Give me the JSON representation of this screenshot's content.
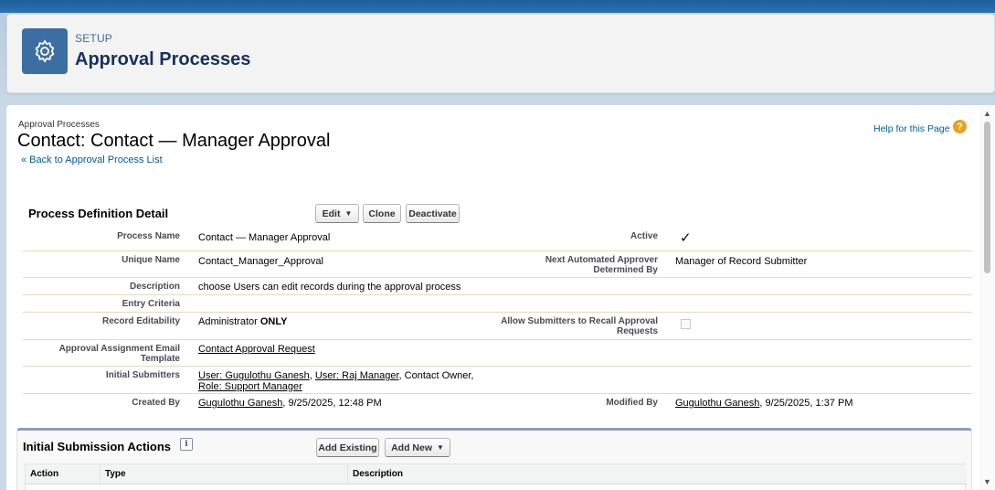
{
  "header": {
    "setup_label": "SETUP",
    "title": "Approval Processes"
  },
  "page": {
    "type_label": "Approval Processes",
    "record_title": "Contact: Contact — Manager Approval",
    "back_link": "Back to Approval Process List",
    "back_prefix": "«",
    "help_link": "Help for this Page",
    "help_icon": "?"
  },
  "detail": {
    "section_title": "Process Definition Detail",
    "buttons": {
      "edit": "Edit",
      "clone": "Clone",
      "deactivate": "Deactivate"
    },
    "fields": {
      "process_name_label": "Process Name",
      "process_name": "Contact — Manager Approval",
      "active_label": "Active",
      "active_checked": true,
      "unique_name_label": "Unique Name",
      "unique_name": "Contact_Manager_Approval",
      "next_approver_label": "Next Automated Approver Determined By",
      "next_approver": "Manager of Record Submitter",
      "description_label": "Description",
      "description": "choose Users can edit records during the approval process",
      "entry_criteria_label": "Entry Criteria",
      "entry_criteria": "",
      "record_editability_label": "Record Editability",
      "record_editability_prefix": "Administrator ",
      "record_editability_bold": "ONLY",
      "allow_recall_label": "Allow Submitters to Recall Approval Requests",
      "allow_recall_checked": false,
      "email_template_label": "Approval Assignment Email Template",
      "email_template": "Contact Approval Request",
      "initial_submitters_label": "Initial Submitters",
      "submitter_1": "User: Gugulothu Ganesh",
      "submitter_2": "User: Raj Manager",
      "submitter_3": "Contact Owner,",
      "submitter_4": "Role: Support Manager",
      "created_by_label": "Created By",
      "created_by_user": "Gugulothu Ganesh",
      "created_by_date": ", 9/25/2025, 12:48 PM",
      "modified_by_label": "Modified By",
      "modified_by_user": "Gugulothu Ganesh",
      "modified_by_date": ", 9/25/2025, 1:37 PM"
    }
  },
  "initial_submission": {
    "title": "Initial Submission Actions",
    "info_icon": "i",
    "add_existing": "Add Existing",
    "add_new": "Add New",
    "columns": [
      "Action",
      "Type",
      "Description"
    ]
  },
  "icons": {
    "setup": "gear-icon",
    "dropdown": "chevron-down-icon",
    "scroll_up": "scroll-up-arrow-icon",
    "scroll_down": "scroll-down-arrow-icon"
  },
  "colors": {
    "brand_bar": "#1d5f9b",
    "setup_icon_bg": "#3b6fa3",
    "link": "#015ba7",
    "help_icon": "#e8a21c",
    "section_border": "#8e9dbe"
  }
}
